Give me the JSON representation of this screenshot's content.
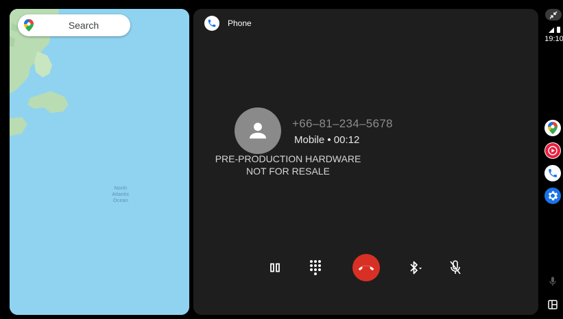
{
  "map": {
    "search_label": "Search",
    "ocean_label": "North\nAtlantic\nOcean",
    "colors": {
      "water": "#8fd3f0",
      "land": "#b8e0b0"
    }
  },
  "phone": {
    "app_title": "Phone",
    "caller_number": "+66–81–234–5678",
    "call_status": "Mobile • 00:12",
    "watermark_line1": "PRE-PRODUCTION HARDWARE",
    "watermark_line2": "NOT FOR RESALE",
    "controls": [
      {
        "name": "hold-button",
        "icon": "pause-icon"
      },
      {
        "name": "dialpad-button",
        "icon": "dialpad-icon"
      },
      {
        "name": "end-call-button",
        "icon": "call-end-icon",
        "color": "#d93025"
      },
      {
        "name": "audio-route-button",
        "icon": "bluetooth-icon"
      },
      {
        "name": "mute-button",
        "icon": "mic-off-icon"
      }
    ]
  },
  "status": {
    "time": "19:10"
  },
  "rail": {
    "apps": [
      {
        "name": "maps",
        "icon": "maps-pin-icon"
      },
      {
        "name": "youtube-music",
        "icon": "youtube-music-icon",
        "color": "#e91e3f"
      },
      {
        "name": "phone",
        "icon": "phone-icon",
        "color": "#1a73e8"
      },
      {
        "name": "settings",
        "icon": "gear-icon",
        "color": "#1a73e8"
      }
    ]
  }
}
